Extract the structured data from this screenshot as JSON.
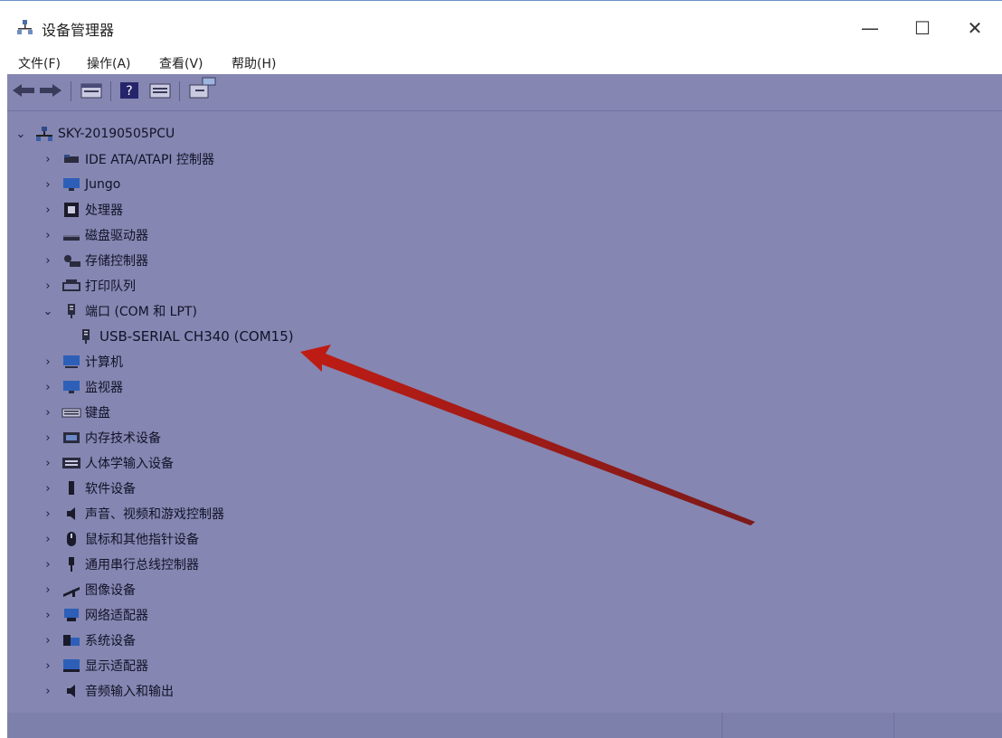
{
  "window": {
    "title": "设备管理器",
    "minimize_glyph": "—",
    "maximize_glyph": "☐",
    "close_glyph": "✕",
    "accent_color": "#6a8fc7"
  },
  "menu": [
    "文件(F)",
    "操作(A)",
    "查看(V)",
    "帮助(H)"
  ],
  "toolbar": {
    "icons": [
      "back-arrow-icon",
      "forward-arrow-icon",
      "properties-icon",
      "help-icon",
      "show-hidden-icon",
      "update-driver-icon"
    ]
  },
  "tree": {
    "root": "SKY-20190505PCU",
    "items": [
      {
        "label": "IDE ATA/ATAPI 控制器",
        "icon": "ide-controller-icon",
        "expanded": false
      },
      {
        "label": "Jungo",
        "icon": "jungo-monitor-icon",
        "expanded": false
      },
      {
        "label": "处理器",
        "icon": "processor-icon",
        "expanded": false
      },
      {
        "label": "磁盘驱动器",
        "icon": "disk-drive-icon",
        "expanded": false
      },
      {
        "label": "存储控制器",
        "icon": "storage-controller-icon",
        "expanded": false
      },
      {
        "label": "打印队列",
        "icon": "printer-icon",
        "expanded": false
      },
      {
        "label": "端口 (COM 和 LPT)",
        "icon": "port-icon",
        "expanded": true
      },
      {
        "label": "USB-SERIAL CH340 (COM15)",
        "icon": "port-icon",
        "child": true
      },
      {
        "label": "计算机",
        "icon": "computer-icon",
        "expanded": false
      },
      {
        "label": "监视器",
        "icon": "monitor-icon",
        "expanded": false
      },
      {
        "label": "键盘",
        "icon": "keyboard-icon",
        "expanded": false
      },
      {
        "label": "内存技术设备",
        "icon": "memory-device-icon",
        "expanded": false
      },
      {
        "label": "人体学输入设备",
        "icon": "hid-icon",
        "expanded": false
      },
      {
        "label": "软件设备",
        "icon": "software-device-icon",
        "expanded": false
      },
      {
        "label": "声音、视频和游戏控制器",
        "icon": "speaker-icon",
        "expanded": false
      },
      {
        "label": "鼠标和其他指针设备",
        "icon": "mouse-icon",
        "expanded": false
      },
      {
        "label": "通用串行总线控制器",
        "icon": "usb-icon",
        "expanded": false
      },
      {
        "label": "图像设备",
        "icon": "camera-icon",
        "expanded": false
      },
      {
        "label": "网络适配器",
        "icon": "network-adapter-icon",
        "expanded": false
      },
      {
        "label": "系统设备",
        "icon": "system-device-icon",
        "expanded": false
      },
      {
        "label": "显示适配器",
        "icon": "display-adapter-icon",
        "expanded": false
      },
      {
        "label": "音频输入和输出",
        "icon": "audio-io-icon",
        "expanded": false
      }
    ]
  },
  "annotation": {
    "icon": "red-arrow-icon",
    "color": "#b51f17"
  },
  "colors": {
    "content_bg": "#8586b1",
    "text": "#121228"
  }
}
